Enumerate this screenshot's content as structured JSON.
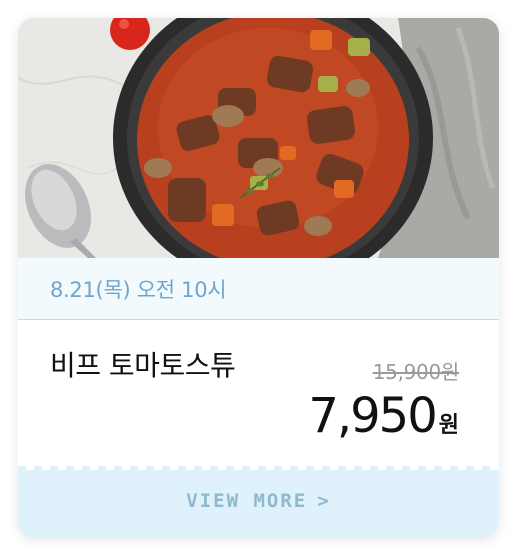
{
  "product": {
    "image_alt": "beef-tomato-stew-photo",
    "date_label": "8.21(목) 오전 10시",
    "name": "비프 토마토스튜",
    "original_price": "15,900원",
    "sale_price": "7,950",
    "currency_unit": "원"
  },
  "cta": {
    "label": "VIEW MORE",
    "chevron": ">"
  },
  "colors": {
    "date_text": "#6ea5cf",
    "date_bg": "#f2fafd",
    "more_bg": "#dff2fb",
    "more_text": "#8fb9cf"
  }
}
